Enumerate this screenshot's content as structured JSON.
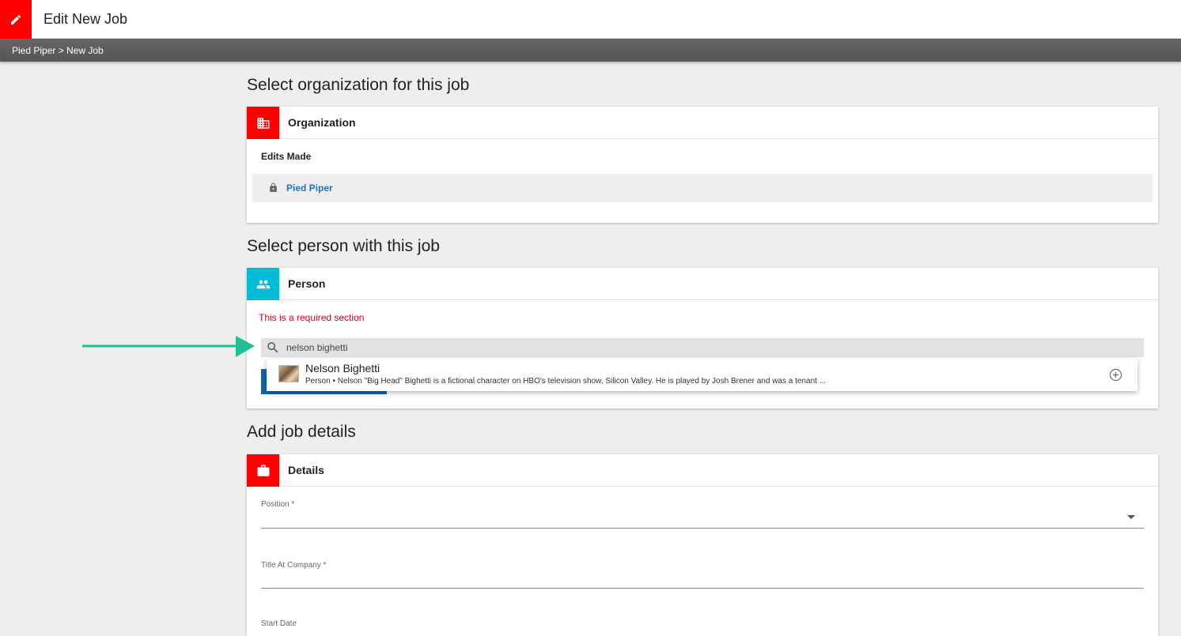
{
  "header": {
    "title": "Edit New Job"
  },
  "breadcrumb": {
    "text": "Pied Piper > New Job"
  },
  "organization_section": {
    "heading": "Select organization for this job",
    "card_title": "Organization",
    "edits_label": "Edits Made",
    "selected_org": "Pied Piper",
    "icon": "building-icon",
    "accent": "#ff0000"
  },
  "person_section": {
    "heading": "Select person with this job",
    "card_title": "Person",
    "required_message": "This is a required section",
    "search_value": "nelson bighetti",
    "icon": "people-icon",
    "accent": "#00bcd4",
    "result": {
      "name": "Nelson Bighetti",
      "description": "Person • Nelson \"Big Head\" Bighetti is a fictional character on HBO's television show, Silicon Valley. He is played by Josh Brener and was a tenant ..."
    }
  },
  "details_section": {
    "heading": "Add job details",
    "card_title": "Details",
    "icon": "briefcase-icon",
    "accent": "#ff0000",
    "fields": [
      {
        "label": "Position *"
      },
      {
        "label": "Title At Company *"
      },
      {
        "label": "Start Date"
      }
    ]
  },
  "colors": {
    "brand_red": "#ff0000",
    "person_cyan": "#00bcd4",
    "link_blue": "#1a73c9",
    "error_red": "#d0021b",
    "arrow_green": "#1fbf98"
  }
}
